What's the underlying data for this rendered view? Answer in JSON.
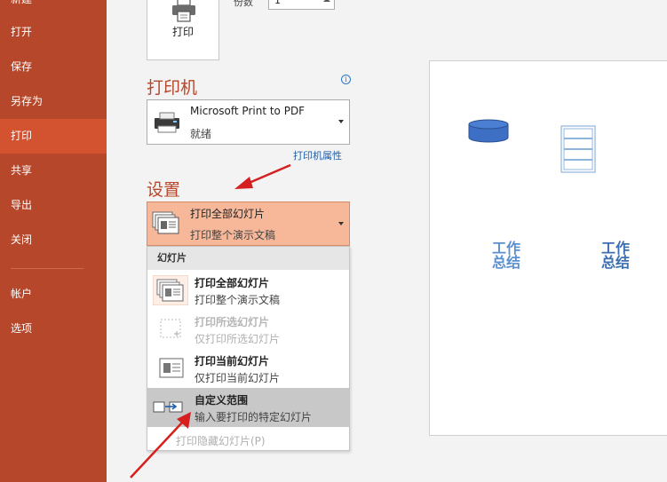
{
  "sidebar": {
    "items": [
      {
        "label": "新建",
        "active": false
      },
      {
        "label": "打开",
        "active": false
      },
      {
        "label": "保存",
        "active": false
      },
      {
        "label": "另存为",
        "active": false
      },
      {
        "label": "打印",
        "active": true
      },
      {
        "label": "共享",
        "active": false
      },
      {
        "label": "导出",
        "active": false
      },
      {
        "label": "关闭",
        "active": false
      }
    ],
    "bottom_items": [
      {
        "label": "帐户"
      },
      {
        "label": "选项"
      }
    ]
  },
  "print": {
    "button_label": "打印",
    "copies_label": "份数",
    "copies_value": "1"
  },
  "printer": {
    "section_title": "打印机",
    "name": "Microsoft Print to PDF",
    "status": "就绪",
    "properties_link": "打印机属性",
    "info_icon": "i"
  },
  "settings": {
    "section_title": "设置",
    "selected_title": "打印全部幻灯片",
    "selected_sub": "打印整个演示文稿",
    "dropdown": {
      "header": "幻灯片",
      "items": [
        {
          "title": "打印全部幻灯片",
          "sub": "打印整个演示文稿",
          "icon": "all-slides-icon",
          "state": "normal"
        },
        {
          "title": "打印所选幻灯片",
          "sub": "仅打印所选幻灯片",
          "icon": "selected-slides-icon",
          "state": "disabled"
        },
        {
          "title": "打印当前幻灯片",
          "sub": "仅打印当前幻灯片",
          "icon": "current-slide-icon",
          "state": "normal"
        },
        {
          "title": "自定义范围",
          "sub": "输入要打印的特定幻灯片",
          "icon": "custom-range-icon",
          "state": "selected"
        }
      ],
      "footer": "打印隐藏幻灯片(P)"
    }
  },
  "preview": {
    "text1": "工作总结",
    "text2": "工作总结"
  },
  "colors": {
    "accent": "#b7472a",
    "active_nav": "#d35230",
    "selected_setting": "#f7b89a",
    "arrow": "#d61f1f",
    "link": "#1f5ea8"
  }
}
